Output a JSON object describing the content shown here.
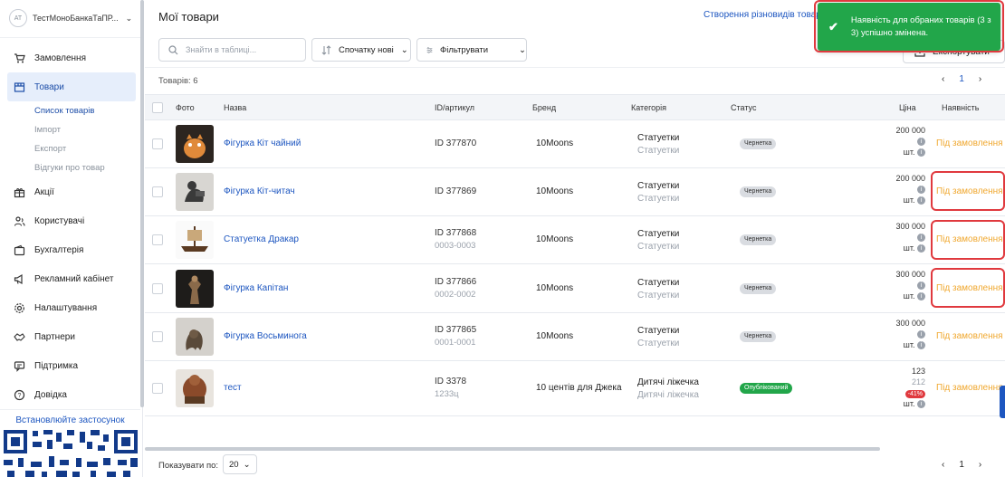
{
  "account": {
    "initials": "AT",
    "name": "ТестМоноБанкаТаПР..."
  },
  "nav": {
    "orders": "Замовлення",
    "products": "Товари",
    "sub": {
      "list": "Список товарів",
      "import": "Імпорт",
      "export": "Експорт",
      "reviews": "Відгуки про товар"
    },
    "promotions": "Акції",
    "users": "Користувачі",
    "accounting": "Бухгалтерія",
    "ads": "Рекламний кабінет",
    "settings": "Налаштування",
    "partners": "Партнери",
    "support": "Підтримка",
    "help": "Довідка"
  },
  "install_app": "Встановлюйте застосунок",
  "header": {
    "title": "Мої товари",
    "create_variants": "Створення різновидів товару",
    "export": "Експортувати"
  },
  "toolbar": {
    "search_placeholder": "Знайти в таблиці...",
    "sort": "Спочатку нові",
    "filter": "Фільтрувати"
  },
  "count": "Товарів: 6",
  "pagination": {
    "current": "1"
  },
  "columns": {
    "photo": "Фото",
    "name": "Назва",
    "id": "ID/артикул",
    "brand": "Бренд",
    "category": "Категорія",
    "status": "Статус",
    "price": "Ціна",
    "availability": "Наявність"
  },
  "rows": [
    {
      "name": "Фігурка Кіт чайний",
      "id": "ID 377870",
      "sku": "",
      "brand": "10Moons",
      "cat": "Статуетки",
      "cat_sub": "Статуетки",
      "status": "Чернетка",
      "price": "200 000",
      "price_old": "",
      "discount": "",
      "unit": "шт.",
      "avail": "Під замовлення"
    },
    {
      "name": "Фігурка Кіт-читач",
      "id": "ID 377869",
      "sku": "",
      "brand": "10Moons",
      "cat": "Статуетки",
      "cat_sub": "Статуетки",
      "status": "Чернетка",
      "price": "200 000",
      "price_old": "",
      "discount": "",
      "unit": "шт.",
      "avail": "Під замовлення"
    },
    {
      "name": "Статуетка Дракар",
      "id": "ID 377868",
      "sku": "0003-0003",
      "brand": "10Moons",
      "cat": "Статуетки",
      "cat_sub": "Статуетки",
      "status": "Чернетка",
      "price": "300 000",
      "price_old": "",
      "discount": "",
      "unit": "шт.",
      "avail": "Під замовлення"
    },
    {
      "name": "Фігурка Капітан",
      "id": "ID 377866",
      "sku": "0002-0002",
      "brand": "10Moons",
      "cat": "Статуетки",
      "cat_sub": "Статуетки",
      "status": "Чернетка",
      "price": "300 000",
      "price_old": "",
      "discount": "",
      "unit": "шт.",
      "avail": "Під замовлення"
    },
    {
      "name": "Фігурка Восьминога",
      "id": "ID 377865",
      "sku": "0001-0001",
      "brand": "10Moons",
      "cat": "Статуетки",
      "cat_sub": "Статуетки",
      "status": "Чернетка",
      "price": "300 000",
      "price_old": "",
      "discount": "",
      "unit": "шт.",
      "avail": "Під замовлення"
    },
    {
      "name": "тест",
      "id": "ID 3378",
      "sku": "1233ц",
      "brand": "10 центів для Джека",
      "cat": "Дитячі ліжечка",
      "cat_sub": "Дитячі ліжечка",
      "status": "Опублікований",
      "price": "123",
      "price_old": "212",
      "discount": "-41%",
      "unit": "шт.",
      "avail": "Під замовлення"
    }
  ],
  "footer": {
    "show_by": "Показувати по:",
    "per_page": "20"
  },
  "toast": {
    "message": "Наявність для обраних товарів (3 з 3) успішно змінена."
  },
  "colors": {
    "accent": "#1d56c0",
    "success": "#22a64a",
    "warning": "#f0a830",
    "danger": "#e0393e"
  }
}
